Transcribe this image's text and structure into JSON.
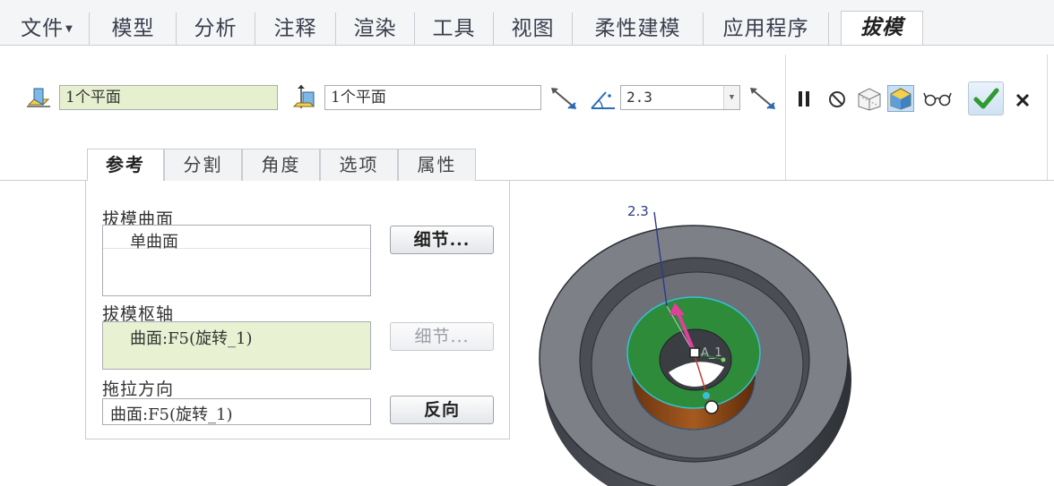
{
  "ribbon_tabs": [
    {
      "label": "文件",
      "has_menu": true
    },
    {
      "label": "模型"
    },
    {
      "label": "分析"
    },
    {
      "label": "注释"
    },
    {
      "label": "渲染"
    },
    {
      "label": "工具"
    },
    {
      "label": "视图"
    },
    {
      "label": "柔性建模"
    },
    {
      "label": "应用程序"
    },
    {
      "label": "拔模",
      "active": true
    }
  ],
  "toolbar": {
    "draft_surfaces_value": "1个平面",
    "draft_hinges_value": "1个平面",
    "angle_value": "2.3",
    "icons": {
      "draft_surface": "draft-surface-icon",
      "draft_hinge": "draft-hinge-icon",
      "flip_1": "flip-direction-icon",
      "angle": "angle-icon",
      "flip_2": "flip-angle-icon",
      "pause": "pause-icon",
      "no_preview": "no-preview-icon",
      "preview_a": "verify-preview-icon",
      "preview_b": "feature-preview-icon",
      "glasses": "glasses-icon",
      "ok": "check-icon",
      "cancel": "close-icon"
    }
  },
  "panel_tabs": [
    {
      "label": "参考",
      "active": true
    },
    {
      "label": "分割"
    },
    {
      "label": "角度"
    },
    {
      "label": "选项"
    },
    {
      "label": "属性"
    }
  ],
  "panel": {
    "draft_surfaces_label": "拔模曲面",
    "draft_surfaces_item": "单曲面",
    "details_button_1": "细节...",
    "draft_hinges_label": "拔模枢轴",
    "draft_hinges_item": "曲面:F5(旋转_1)",
    "details_button_2": "细节...",
    "pull_direction_label": "拖拉方向",
    "pull_direction_item": "曲面:F5(旋转_1)",
    "flip_button": "反向"
  },
  "viewport": {
    "dimension_label": "2.3",
    "axis_label": "A_1"
  },
  "colors": {
    "green_field": "#e6f0cf",
    "accept_green": "#2f9a2f",
    "selected_surface": "#2e8b3a",
    "part_gray": "#7d8187",
    "dimension_blue": "#2b3a8c",
    "arrow_pink": "#e0409a"
  }
}
